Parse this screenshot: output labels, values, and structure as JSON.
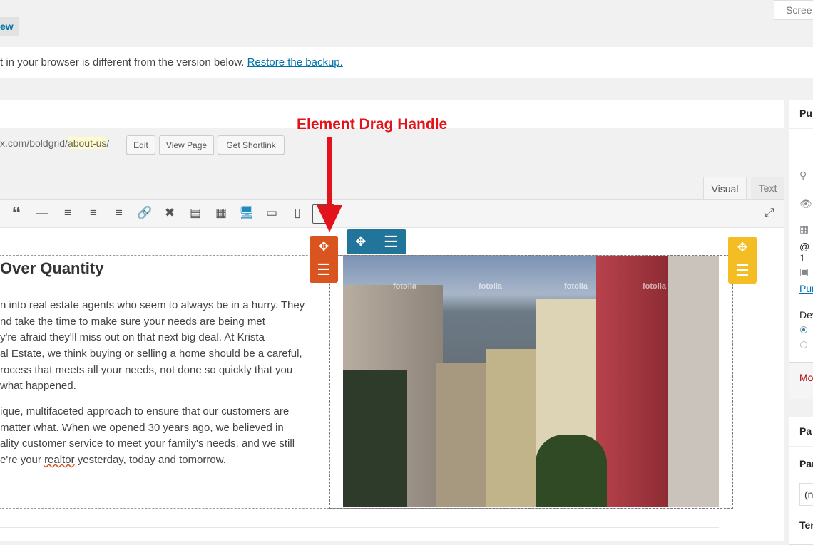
{
  "header": {
    "preview_label": "ew",
    "screen_options_label": "Scree"
  },
  "notice": {
    "text": "t in your browser is different from the version below.",
    "link": "Restore the backup."
  },
  "permalink": {
    "prefix": "x.com/boldgrid/",
    "slug": "about-us",
    "suffix": "/",
    "edit_label": "Edit",
    "view_label": "View Page",
    "shortlink_label": "Get Shortlink"
  },
  "editor_tabs": {
    "visual": "Visual",
    "text": "Text"
  },
  "toolbar": {
    "icons": [
      "blockquote-icon",
      "horizontal-line-icon",
      "align-left-icon",
      "align-center-icon",
      "align-right-icon",
      "link-icon",
      "unlink-icon",
      "read-more-icon",
      "toolbar-toggle-icon",
      "desktop-view-icon",
      "tablet-view-icon",
      "phone-view-icon",
      "extra-icon"
    ],
    "active_color": "#1e8cbe"
  },
  "annotation": {
    "text": "Element Drag Handle",
    "color": "#e3131b"
  },
  "content": {
    "heading": "Over Quantity",
    "paragraph1": [
      "n into real estate agents who seem to always be in a hurry. They",
      "nd take the time to make sure your needs are being met",
      "y're afraid they'll miss out on that next big deal. At Krista",
      "al Estate, we think buying or selling a home should be a careful,",
      "rocess that meets all your needs, not done so quickly that you",
      "what happened."
    ],
    "paragraph2": [
      "ique, multifaceted approach to ensure that our customers are",
      "matter what. When we opened 30 years ago, we believed in",
      "ality customer service to meet your family's needs, and we still",
      "e're your ",
      "realtor",
      " yesterday, today and tomorrow."
    ],
    "watermark": "fotolia"
  },
  "handles": {
    "column_color": "#d9541e",
    "row_color": "#21759b",
    "image_color": "#f5bd24"
  },
  "sidebar": {
    "publish_title": "Pu",
    "schedule_text": "@ 1",
    "link_text": "Pur",
    "device_label": "Dev",
    "move_trash": "Mo",
    "page_attr_title": "Pa",
    "parent_label": "Par",
    "parent_value": "(n",
    "template_label": "Ter"
  }
}
